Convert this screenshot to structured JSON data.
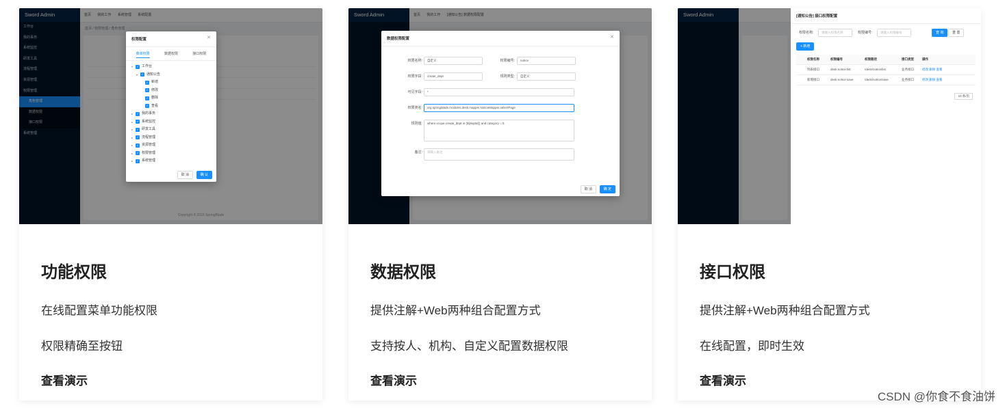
{
  "cards": [
    {
      "title": "功能权限",
      "line1": "在线配置菜单功能权限",
      "line2": "权限精确至按钮",
      "demo": "查看演示",
      "shot": {
        "logo": "Sword Admin",
        "topbar": [
          "首页",
          "我的工作",
          "系统管理",
          "系统配置"
        ],
        "crumb": "首页 / 权限管理 / 角色管理",
        "menu": [
          "工作台",
          "我的事务",
          "系统监控",
          "研发工具",
          "流程管理",
          "资源管理",
          "权限管理",
          "角色管理",
          "数据权限",
          "接口权限",
          "系统管理"
        ],
        "modal": {
          "title": "权限配置",
          "tabs": [
            "菜单权限",
            "数据权限",
            "接口权限"
          ],
          "tree": [
            "工作台",
            "通知公告",
            "新增",
            "修改",
            "删除",
            "查看",
            "我的事务",
            "系统监控",
            "研发工具",
            "流程管理",
            "资源管理",
            "权限管理",
            "系统管理"
          ],
          "cancel": "取 消",
          "ok": "确 认"
        },
        "footer": "Copyright © 2019 SpringBlade"
      }
    },
    {
      "title": "数据权限",
      "line1": "提供注解+Web两种组合配置方式",
      "line2": "支持按人、机构、自定义配置数据权限",
      "demo": "查看演示",
      "shot": {
        "logo": "Sword Admin",
        "topbar": [
          "首页",
          "我的工作",
          "[通知公告] 数据权限配置"
        ],
        "modal": {
          "title": "数据权限配置",
          "fields": {
            "name_label": "权限名称:",
            "name_value": "自定义",
            "code_label": "权限编号:",
            "code_value": "notice",
            "column_label": "权限字段:",
            "column_value": "create_dept",
            "type_label": "规则类型:",
            "type_value": "自定义",
            "visible_label": "可见字段:",
            "visible_value": "*",
            "class_label": "权限类名:",
            "class_value": "org.springblade.modules.desk.mapper.NoticeMapper.selectPage",
            "sql_label": "规则值:",
            "sql_value": "where scope.create_dept in (${deptId}) and category = 5",
            "remark_label": "备注:",
            "remark_placeholder": "请输入备注"
          },
          "cancel": "取 消",
          "ok": "确 定"
        }
      }
    },
    {
      "title": "接口权限",
      "line1": "提供注解+Web两种组合配置方式",
      "line2": "在线配置，即时生效",
      "demo": "查看演示",
      "shot": {
        "logo": "Sword Admin",
        "panel_title": "[通知公告] 接口权限配置",
        "search_name_label": "权限名称:",
        "search_name_ph": "请输入权限名称",
        "search_code_label": "权限编号:",
        "search_code_ph": "请输入权限编号",
        "query": "查 询",
        "reset": "重 置",
        "add": "+ 新增",
        "headers": [
          "权限名称",
          "权限编号",
          "权限路径",
          "接口类型",
          "操作"
        ],
        "rows": [
          [
            "列表接口",
            "desk:notice:list",
            "/desk/notice/list",
            "业务接口",
            "修改 删除 查看"
          ],
          [
            "新增接口",
            "desk:notice:save",
            "/desk/notice/save",
            "业务接口",
            "修改 删除 查看"
          ]
        ],
        "pager": "10 条/页"
      }
    }
  ],
  "watermark": "CSDN @你食不食油饼"
}
